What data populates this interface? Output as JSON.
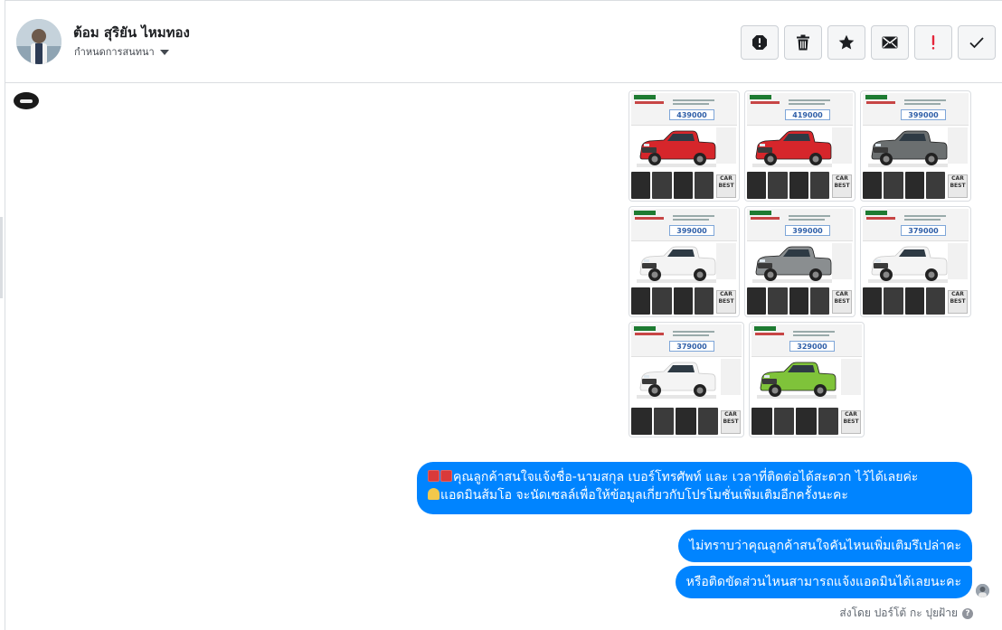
{
  "header": {
    "contact_name": "ต้อม สุริยัน ไหมทอง",
    "assign_label": "กำหนดการสนทนา",
    "actions": [
      {
        "name": "report-spam-icon",
        "color": "#1c1e21"
      },
      {
        "name": "trash-icon",
        "color": "#1c1e21"
      },
      {
        "name": "star-icon",
        "color": "#1c1e21"
      },
      {
        "name": "envelope-icon",
        "color": "#1c1e21"
      },
      {
        "name": "exclamation-icon",
        "color": "#e4253a"
      },
      {
        "name": "checkmark-icon",
        "color": "#1c1e21"
      }
    ]
  },
  "gallery": {
    "rows": [
      [
        {
          "price": "439000",
          "car_color": "#d6262b"
        },
        {
          "price": "419000",
          "car_color": "#d6262b"
        },
        {
          "price": "399000",
          "car_color": "#6b6f70"
        }
      ],
      [
        {
          "price": "399000",
          "car_color": "#f4f4f4"
        },
        {
          "price": "399000",
          "car_color": "#8a8e90"
        },
        {
          "price": "379000",
          "car_color": "#f4f4f4"
        }
      ],
      [
        {
          "price": "379000",
          "car_color": "#f4f4f4"
        },
        {
          "price": "329000",
          "car_color": "#7fc33a"
        }
      ]
    ],
    "seal_text": "CAR BEST"
  },
  "messages": [
    {
      "line1": "คุณลูกค้าสนใจแจ้งชื่อ-นามสกุล เบอร์โทรศัพท์ และ เวลาที่ติดต่อได้สะดวก ไว้ได้เลยค่ะ",
      "line2": "แอดมินส้มโอ จะนัดเซลล์เพื่อให้ข้อมูลเกี่ยวกับโปรโมชั่นเพิ่มเติมอีกครั้งนะคะ"
    },
    {
      "text": "ไม่ทราบว่าคุณลูกค้าสนใจคันไหนเพิ่มเติมรึเปล่าคะ"
    },
    {
      "text": "หรือติดขัดส่วนไหนสามารถแจ้งแอดมินได้เลยนะคะ"
    }
  ],
  "footer": {
    "sent_by": "ส่งโดย ปอร์โต้ กะ ปุยฝ้าย",
    "help": "?"
  },
  "colors": {
    "bubble": "#0084ff",
    "border": "#dadde1"
  }
}
